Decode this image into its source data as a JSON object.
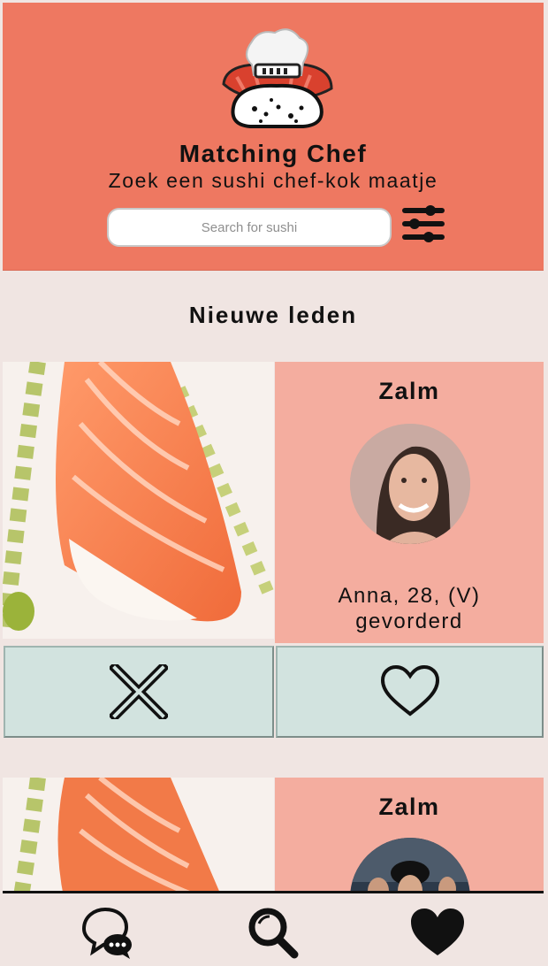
{
  "header": {
    "logo_icon": "sushi-chef-logo-icon",
    "title": "Matching Chef",
    "subtitle": "Zoek een sushi chef-kok maatje",
    "search": {
      "placeholder": "Search for sushi",
      "value": ""
    },
    "filter_icon": "sliders-icon"
  },
  "section": {
    "title": "Nieuwe leden"
  },
  "cards": [
    {
      "category": "Zalm",
      "name_line": "Anna, 28, (V)",
      "level": "gevorderd",
      "sushi_image_icon": "salmon-nigiri-image",
      "avatar_icon": "member-photo-avatar",
      "reject_icon": "close-x-icon",
      "like_icon": "heart-outline-icon"
    },
    {
      "category": "Zalm",
      "sushi_image_icon": "salmon-nigiri-image",
      "avatar_icon": "member-photo-avatar"
    }
  ],
  "nav": [
    {
      "icon": "chat-bubbles-icon"
    },
    {
      "icon": "search-icon"
    },
    {
      "icon": "heart-filled-icon"
    }
  ],
  "colors": {
    "header_bg": "#ee7861",
    "page_bg": "#f0e5e2",
    "profile_bg": "#f4ad9f",
    "action_bg": "#d2e3df"
  }
}
